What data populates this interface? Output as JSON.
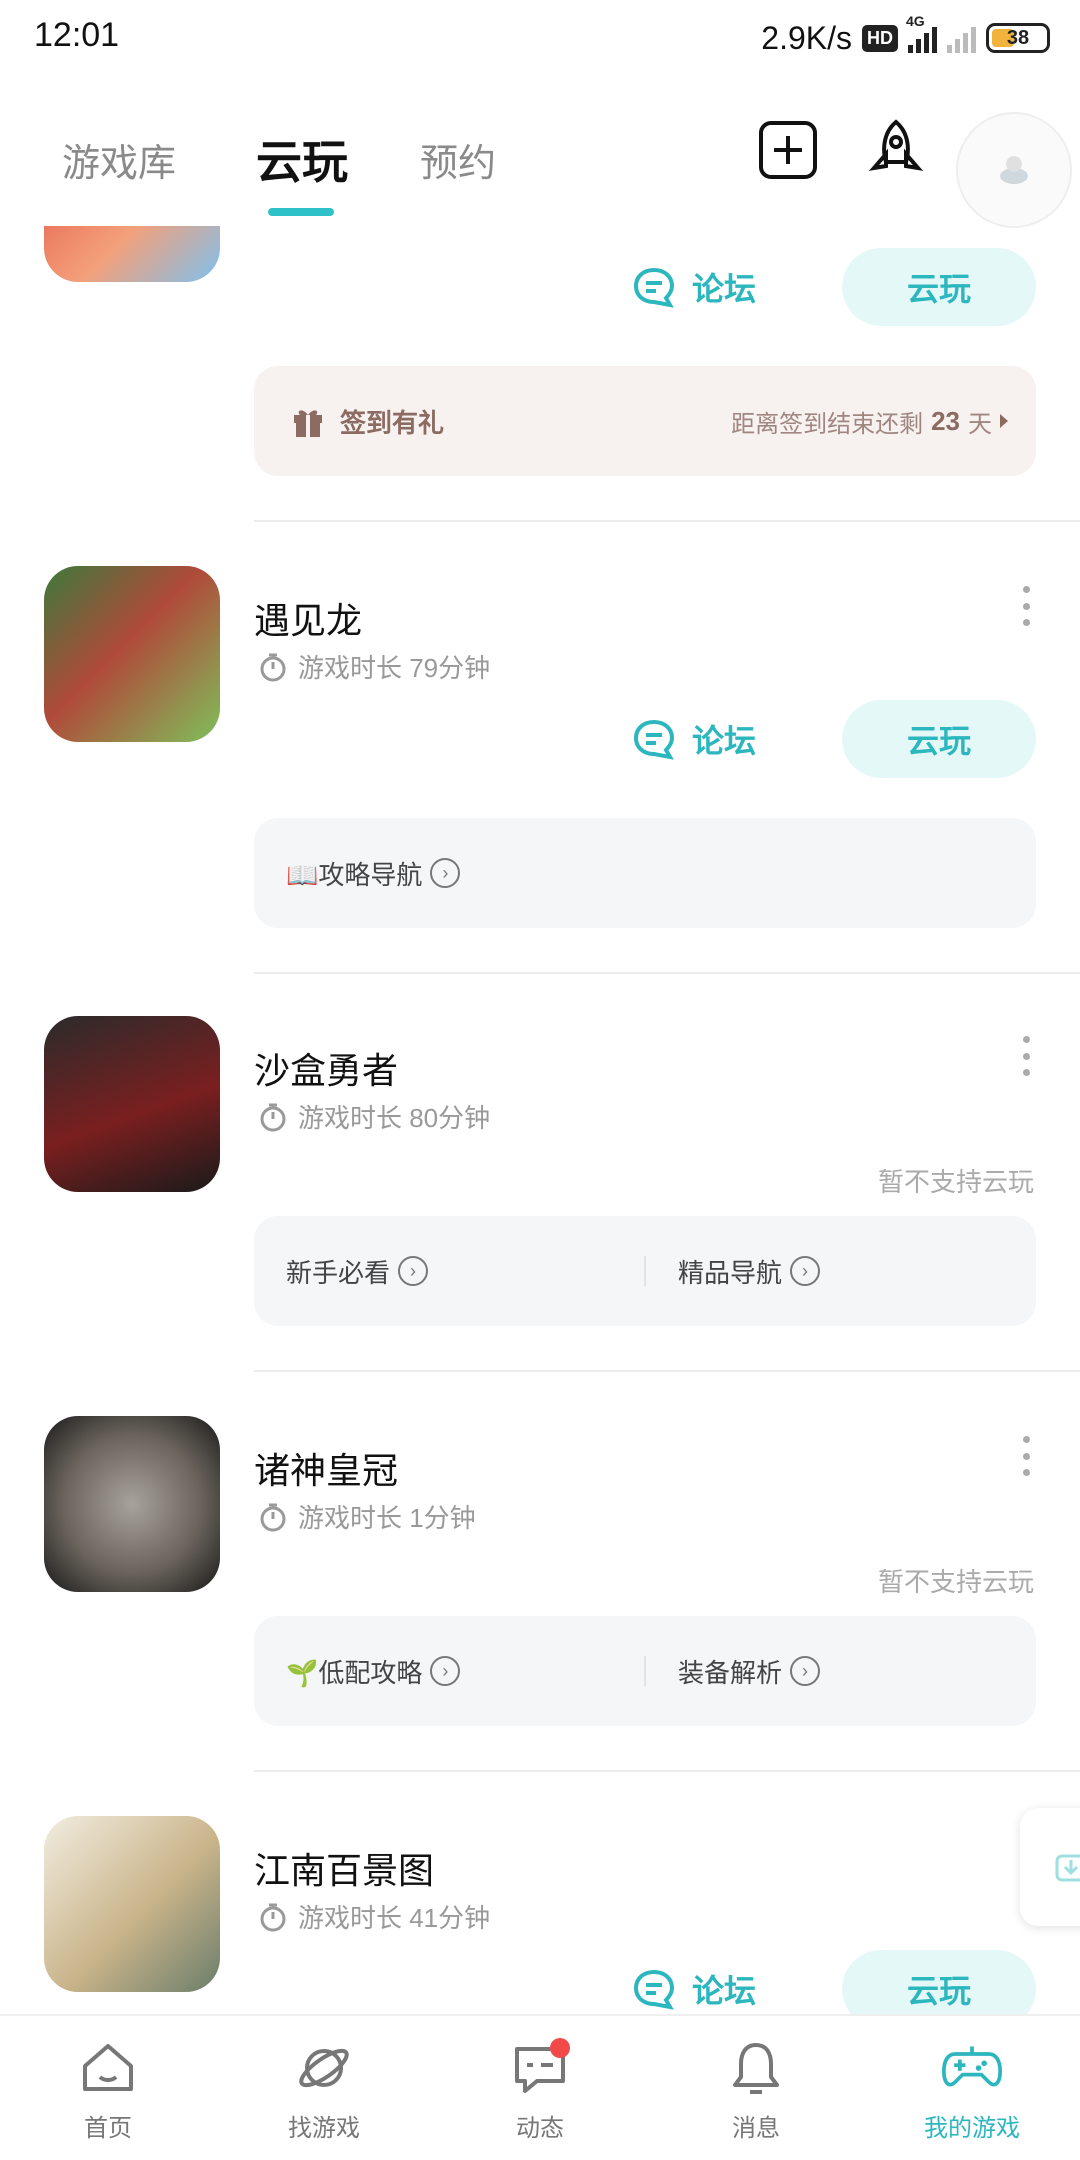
{
  "status_bar": {
    "time": "12:01",
    "speed": "2.9K/s",
    "hd": "HD",
    "network": "4G",
    "battery": "38"
  },
  "tabs": [
    {
      "label": "游戏库",
      "active": false
    },
    {
      "label": "云玩",
      "active": true
    },
    {
      "label": "预约",
      "active": false
    }
  ],
  "colors": {
    "accent": "#2cb7bf",
    "signin_text": "#8b6b62"
  },
  "games": [
    {
      "name": "",
      "forum_label": "论坛",
      "cloud_label": "云玩",
      "signin": {
        "label": "签到有礼",
        "remaining_prefix": "距离签到结束还剩",
        "remaining_days": "23",
        "remaining_suffix": "天"
      }
    },
    {
      "name": "遇见龙",
      "play_time": "游戏时长 79分钟",
      "forum_label": "论坛",
      "cloud_label": "云玩",
      "guides": [
        "📖攻略导航"
      ]
    },
    {
      "name": "沙盒勇者",
      "play_time": "游戏时长 80分钟",
      "unsupported": "暂不支持云玩",
      "guides": [
        "新手必看",
        "精品导航"
      ]
    },
    {
      "name": "诸神皇冠",
      "play_time": "游戏时长 1分钟",
      "unsupported": "暂不支持云玩",
      "guides": [
        "🌱低配攻略",
        "装备解析"
      ]
    },
    {
      "name": "江南百景图",
      "play_time": "游戏时长 41分钟",
      "forum_label": "论坛",
      "cloud_label": "云玩"
    }
  ],
  "bottom_nav": [
    {
      "label": "首页",
      "icon": "home-icon"
    },
    {
      "label": "找游戏",
      "icon": "planet-icon"
    },
    {
      "label": "动态",
      "icon": "chat-icon"
    },
    {
      "label": "消息",
      "icon": "bell-icon"
    },
    {
      "label": "我的游戏",
      "icon": "gamepad-icon",
      "active": true
    }
  ]
}
